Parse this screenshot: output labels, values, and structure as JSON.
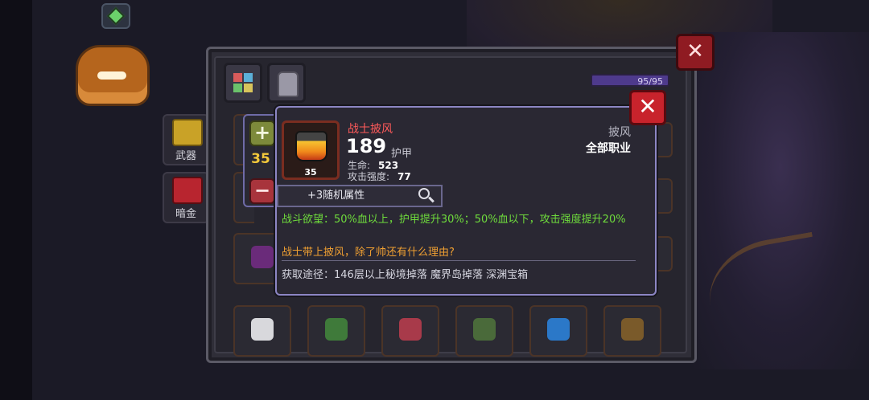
{
  "side_tabs": [
    {
      "label": "武器"
    },
    {
      "label": "暗金"
    }
  ],
  "inventory": {
    "capacity_text": "95/95",
    "close_glyph": "✕"
  },
  "quantity": {
    "plus_glyph": "+",
    "value": "35",
    "minus_glyph": "−"
  },
  "tooltip": {
    "close_glyph": "✕",
    "item_level": "35",
    "item_name": "战士披风",
    "power": "189",
    "power_label": "护甲",
    "stats": [
      {
        "label": "生命:",
        "value": "523"
      },
      {
        "label": "攻击强度:",
        "value": "77"
      }
    ],
    "item_type": "披风",
    "item_class": "全部职业",
    "random_attr_label": "+3随机属性",
    "skill_text": "战斗欲望：50%血以上，护甲提升30%；50%血以下，攻击强度提升20%",
    "flavor_text": "战士带上披风，除了帅还有什么理由?",
    "source_text": "获取途径：146层以上秘境掉落 魔界岛掉落 深渊宝箱"
  },
  "colors": {
    "item_name": "#ff5a5a",
    "skill": "#6fdc3c",
    "flavor": "#f0a032",
    "quantity": "#f3c93b"
  },
  "icons": [
    "map-icon",
    "grid-icon",
    "armor-icon",
    "close-icon",
    "plus-icon",
    "minus-icon",
    "magnifier-icon"
  ]
}
